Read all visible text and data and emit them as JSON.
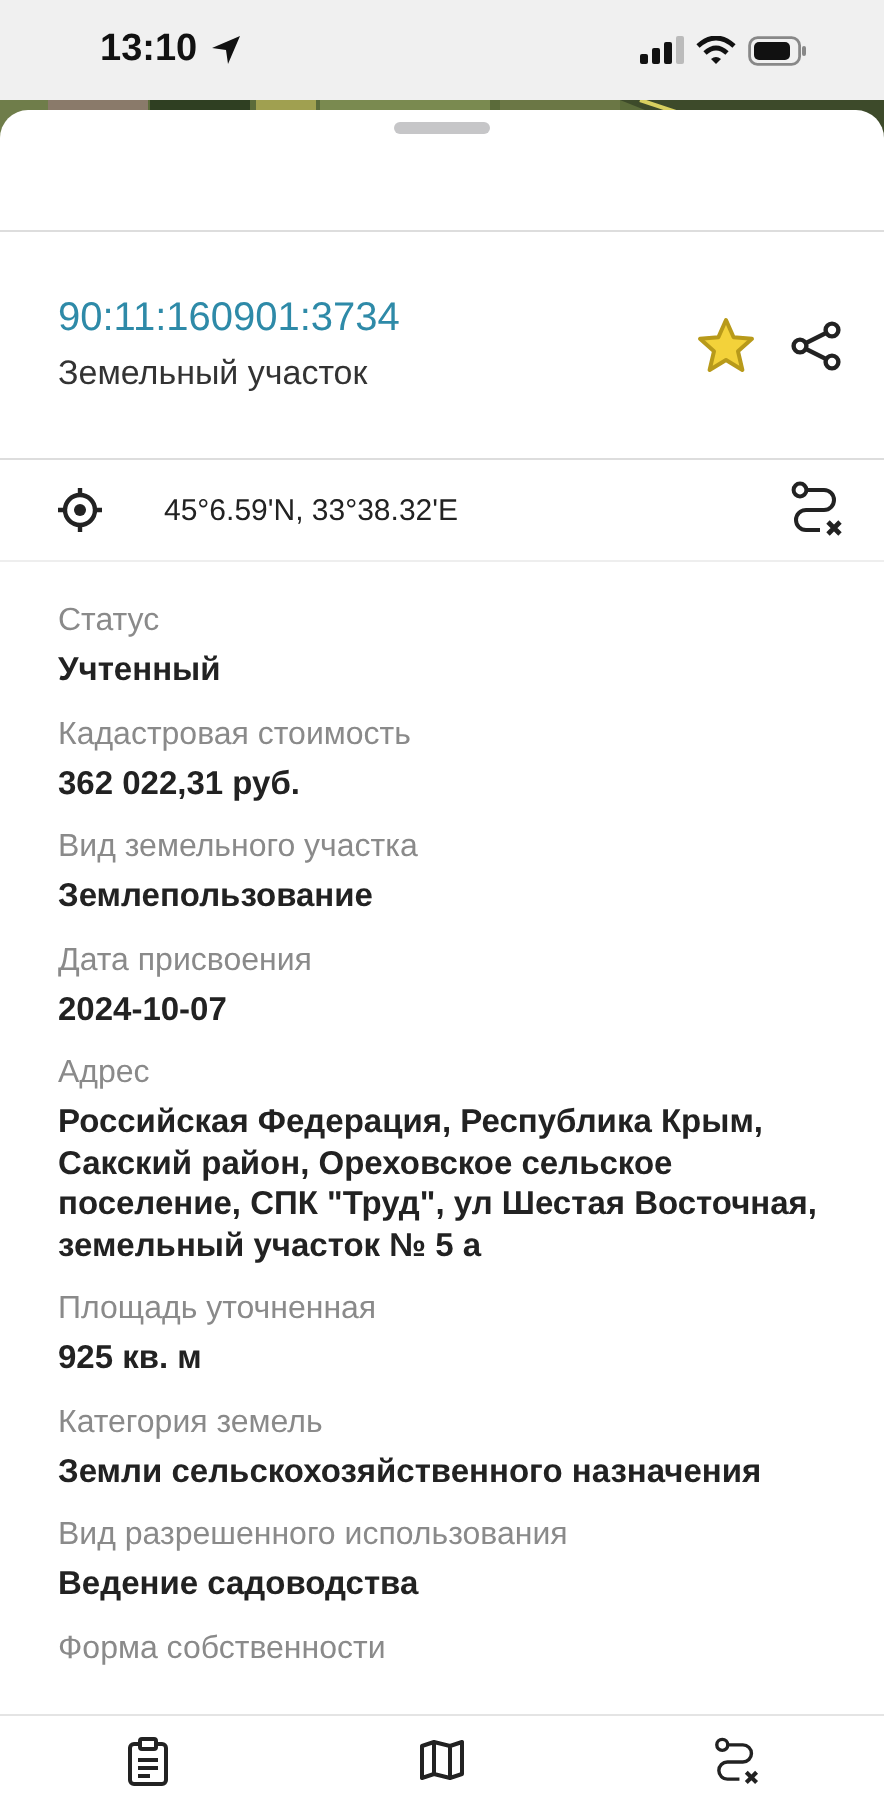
{
  "status_bar": {
    "time": "13:10"
  },
  "header": {
    "cadastral_number": "90:11:160901:3734",
    "object_type": "Земельный участок",
    "favorite": true
  },
  "location": {
    "coordinates": "45°6.59'N, 33°38.32'E"
  },
  "fields": [
    {
      "label": "Статус",
      "value": "Учтенный"
    },
    {
      "label": "Кадастровая стоимость",
      "value": "362 022,31 руб."
    },
    {
      "label": "Вид земельного участка",
      "value": "Землепользование"
    },
    {
      "label": "Дата присвоения",
      "value": "2024-10-07"
    },
    {
      "label": "Адрес",
      "value": "Российская Федерация, Республика Крым, Сакский район, Ореховское сельское поселение, СПК \"Труд\", ул Шестая Восточная, земельный участок № 5 а"
    },
    {
      "label": "Площадь уточненная",
      "value": "925 кв. м"
    },
    {
      "label": "Категория земель",
      "value": "Земли сельскохозяйственного назначения"
    },
    {
      "label": "Вид разрешенного использования",
      "value": "Ведение садоводства"
    },
    {
      "label": "Форма собственности"
    }
  ]
}
